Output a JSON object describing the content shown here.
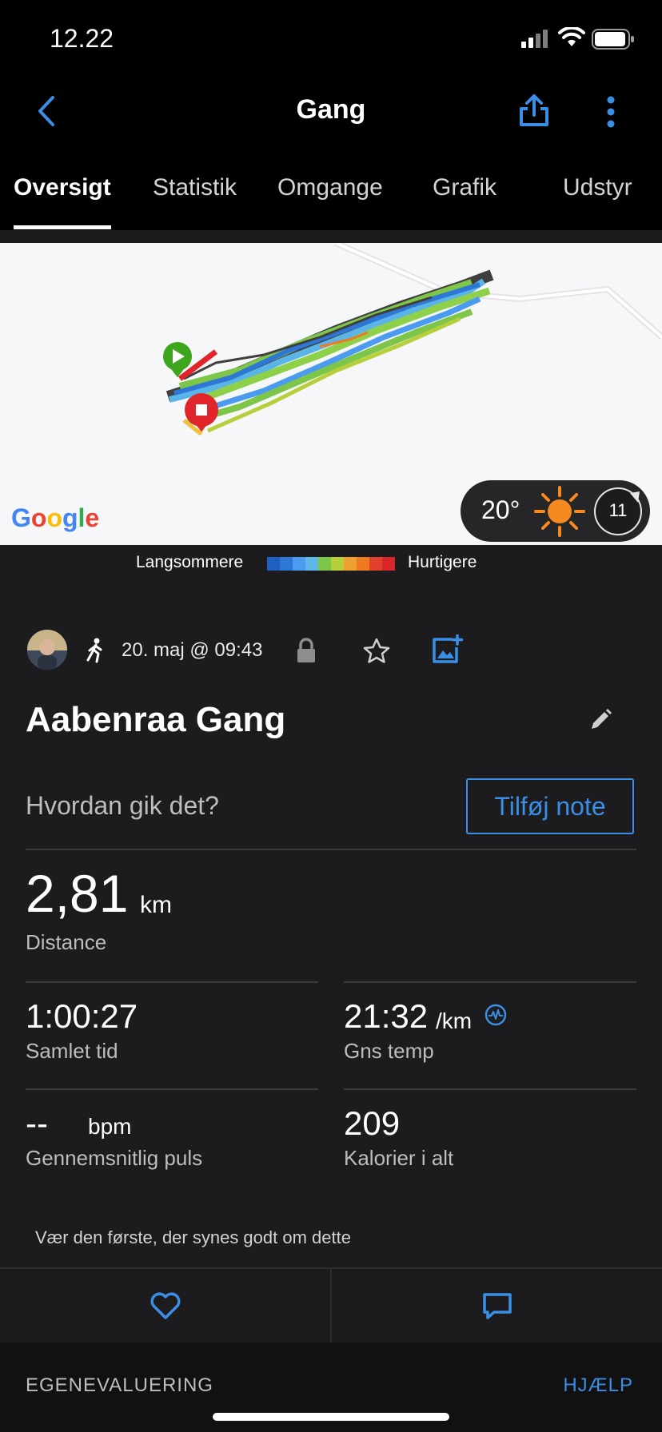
{
  "status": {
    "time": "12.22"
  },
  "nav": {
    "title": "Gang"
  },
  "tabs": [
    {
      "label": "Oversigt",
      "active": true
    },
    {
      "label": "Statistik"
    },
    {
      "label": "Omgange"
    },
    {
      "label": "Grafik"
    },
    {
      "label": "Udstyr"
    }
  ],
  "map": {
    "attribution": "Google",
    "legend_slow": "Langsommere",
    "legend_fast": "Hurtigere",
    "legend_colors": [
      "#1f5fc0",
      "#2f77d6",
      "#4b9cf0",
      "#5fb7e8",
      "#7ec64a",
      "#b7cf3a",
      "#f0a030",
      "#f07a22",
      "#e0422b",
      "#d8262a"
    ],
    "weather_temp": "20°",
    "wind": "11"
  },
  "activity": {
    "date": "20. maj @ 09:43",
    "title": "Aabenraa Gang",
    "note_question": "Hvordan gik det?",
    "note_button": "Tilføj note"
  },
  "stats": {
    "distance": {
      "value": "2,81",
      "unit": "km",
      "label": "Distance"
    },
    "total_time": {
      "value": "1:00:27",
      "label": "Samlet tid"
    },
    "avg_pace": {
      "value": "21:32",
      "unit": "/km",
      "label": "Gns temp"
    },
    "avg_hr": {
      "value": "--",
      "unit": "bpm",
      "label": "Gennemsnitlig puls"
    },
    "calories": {
      "value": "209",
      "label": "Kalorier i alt"
    }
  },
  "social": {
    "likes_prompt": "Vær den første, der synes godt om dette"
  },
  "footer": {
    "section": "EGENEVALUERING",
    "help": "HJÆLP"
  },
  "colors": {
    "accent": "#3b8ee5",
    "start": "#3fa51f",
    "stop": "#e0262b"
  }
}
